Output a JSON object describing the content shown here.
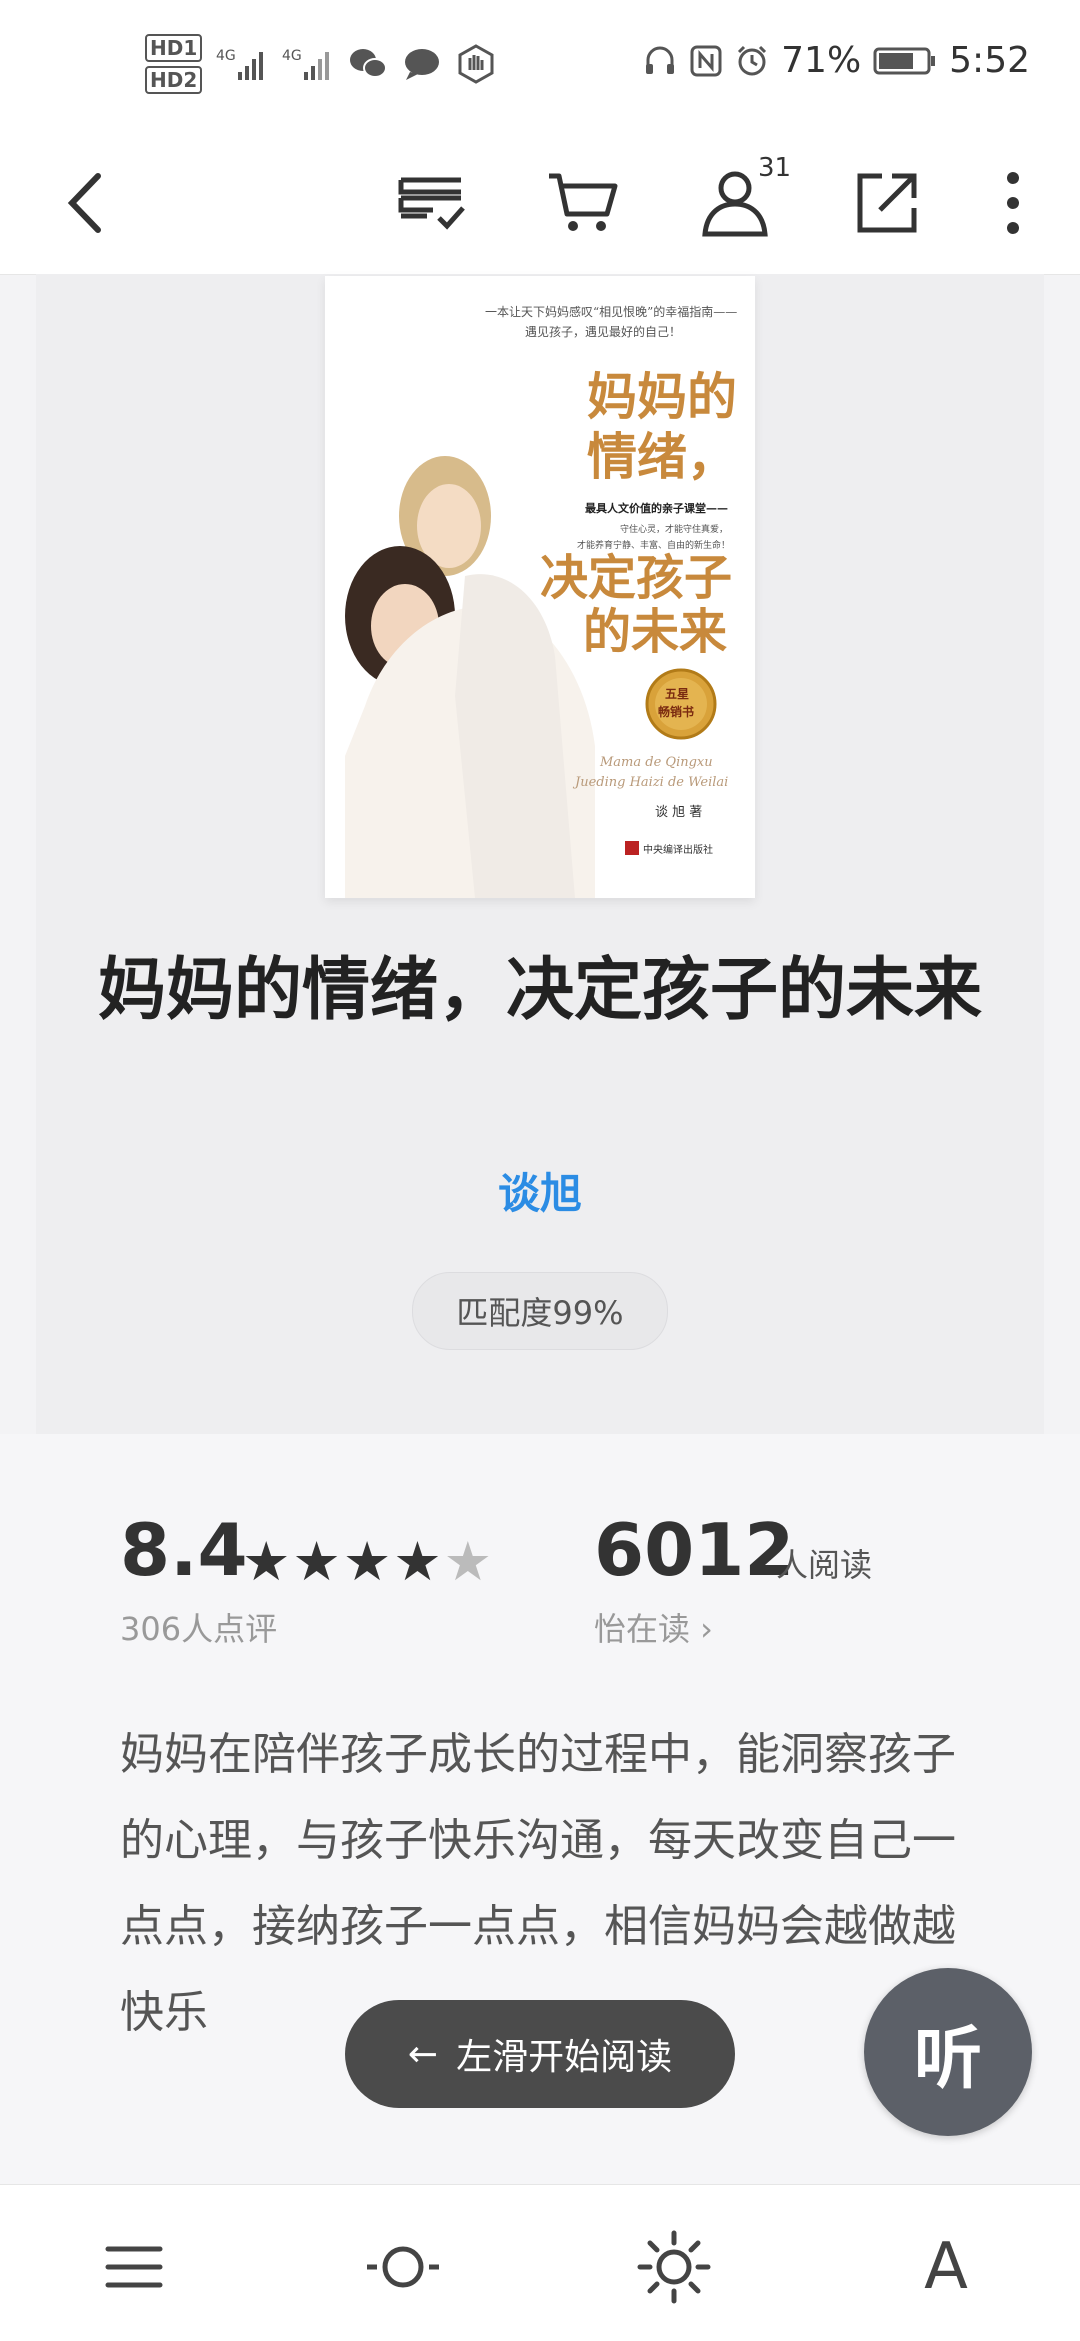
{
  "status_bar": {
    "left_icons": [
      "hd1-icon",
      "hd2-icon",
      "signal-4g-icon",
      "signal-4g-icon",
      "wechat-icon",
      "chat-bubble-icon",
      "hand-icon"
    ],
    "network_labels": [
      "4G",
      "4G"
    ],
    "battery_percent": "71%",
    "time": "5:52"
  },
  "navbar": {
    "icons": [
      "back-icon",
      "bookshelf-icon",
      "cart-icon",
      "user-icon",
      "share-icon",
      "more-icon"
    ],
    "user_badge": "31"
  },
  "book": {
    "cover": {
      "tagline_1": "一本让天下妈妈感叹“相见恨晚”的幸福指南——",
      "tagline_2": "遇见孩子，遇见最好的自己！",
      "title_1": "妈妈的",
      "title_2": "情绪，",
      "subtitle": "最具人文价值的亲子课堂——",
      "blurb_1": "守住心灵，才能守住真爱，",
      "blurb_2": "才能养育宁静、丰富、自由的新生命！",
      "title_3": "决定孩子",
      "title_4": "的未来",
      "seal_1": "五星",
      "seal_2": "畅销书",
      "pinyin_1": "Mama de Qingxu",
      "pinyin_2": "Jueding Haizi de Weilai",
      "author_line": "谈 旭  著",
      "publisher": "中央编译出版社"
    },
    "title": "妈妈的情绪，决定孩子的未来",
    "author": "谈旭",
    "match": "匹配度99%"
  },
  "stats": {
    "score": "8.4",
    "stars": "★★★★",
    "half_star": "★",
    "reviews": "306人点评",
    "readers": "6012",
    "readers_unit": "人阅读",
    "reading_link": "怡在读 ›"
  },
  "description": "妈妈在陪伴孩子成长的过程中，能洞察孩子的心理，与孩子快乐沟通，每天改变自己一点点，接纳孩子一点点，相信妈妈会越做越快乐",
  "swipe_hint": {
    "arrow": "←",
    "label": "左滑开始阅读"
  },
  "listen_button": "听",
  "bottom_bar": {
    "icons": [
      "menu-icon",
      "progress-icon",
      "brightness-icon",
      "font-icon"
    ],
    "font_label": "A"
  },
  "colors": {
    "author_link": "#2b8ce4",
    "cover_title": "#c8893c",
    "pill_dark": "#4b4b4b",
    "listen_button": "#5c6068"
  }
}
